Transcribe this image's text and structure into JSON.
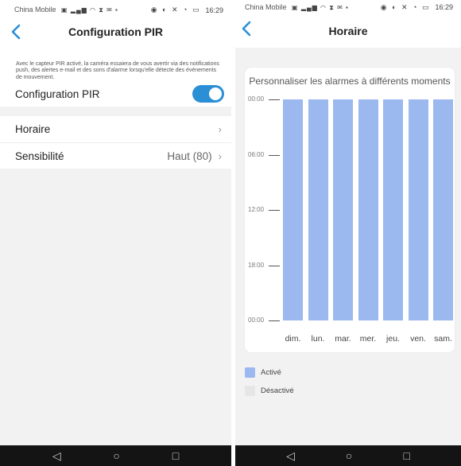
{
  "status": {
    "carrier": "China Mobile",
    "time": "16:29"
  },
  "pir": {
    "title": "Configuration PIR",
    "description": "Avec le capteur PIR activé, la caméra essaiera de vous avertir via des notifications push, des alertes e-mail et des sons d'alarme lorsqu'elle détecte des événements de mouvement.",
    "toggle_label": "Configuration PIR",
    "toggle_on": true,
    "schedule_label": "Horaire",
    "sensitivity_label": "Sensibilité",
    "sensitivity_value": "Haut (80)"
  },
  "schedule": {
    "title": "Horaire",
    "card_title": "Personnaliser les alarmes à différents moments",
    "time_ticks": [
      "00:00",
      "06:00",
      "12:00",
      "18:00",
      "00:00"
    ],
    "days": [
      "dim.",
      "lun.",
      "mar.",
      "mer.",
      "jeu.",
      "ven.",
      "sam."
    ],
    "day_active_fraction": [
      1,
      1,
      1,
      1,
      1,
      1,
      1
    ],
    "legend_active": "Activé",
    "legend_inactive": "Désactivé",
    "active_color": "#9bb8ef",
    "inactive_color": "#e6e6e6",
    "accent_color": "#2b8fd6"
  }
}
